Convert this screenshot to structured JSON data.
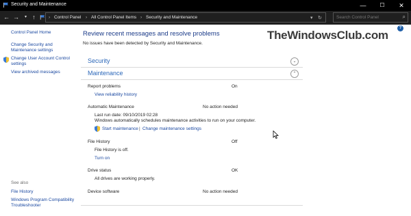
{
  "window": {
    "title": "Security and Maintenance",
    "minimize": "—",
    "maximize": "☐",
    "close": "✕"
  },
  "address": {
    "crumbs": [
      "Control Panel",
      "All Control Panel Items",
      "Security and Maintenance"
    ],
    "search_placeholder": "Search Control Panel"
  },
  "help": "?",
  "sidebar": {
    "home": "Control Panel Home",
    "change_settings": "Change Security and Maintenance settings",
    "uac": "Change User Account Control settings",
    "archived": "View archived messages",
    "see_also_heading": "See also",
    "file_history": "File History",
    "compat": "Windows Program Compatibility Troubleshooter"
  },
  "main": {
    "title": "Review recent messages and resolve problems",
    "subtitle": "No issues have been detected by Security and Maintenance.",
    "watermark": "TheWindowsClub.com"
  },
  "security": {
    "label": "Security"
  },
  "maintenance": {
    "label": "Maintenance",
    "report_problems": {
      "label": "Report problems",
      "status": "On",
      "link": "View reliability history"
    },
    "auto_maint": {
      "label": "Automatic Maintenance",
      "status": "No action needed",
      "last_run": "Last run date: 09/10/2019 02:28",
      "desc": "Windows automatically schedules maintenance activities to run on your computer.",
      "start": "Start maintenance",
      "sep": "|",
      "change": "Change maintenance settings"
    },
    "file_history": {
      "label": "File History",
      "status": "Off",
      "desc": "File History is off.",
      "link": "Turn on"
    },
    "drive_status": {
      "label": "Drive status",
      "status": "OK",
      "desc": "All drives are working properly."
    },
    "device_software": {
      "label": "Device software",
      "status": "No action needed"
    }
  }
}
